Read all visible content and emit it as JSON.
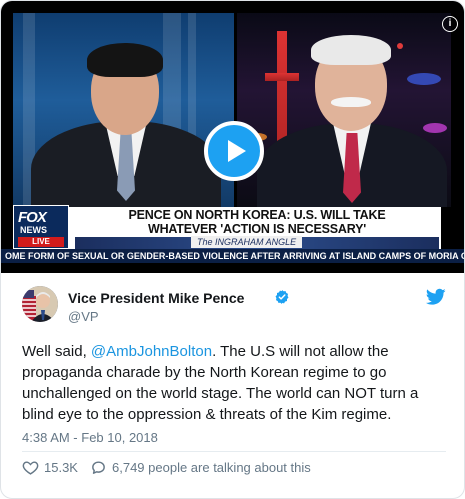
{
  "media": {
    "headline_line1": "PENCE ON NORTH KOREA: U.S. WILL TAKE",
    "headline_line2": "WHATEVER 'ACTION IS NECESSARY'",
    "channel_name": "FOX",
    "channel_sub": "NEWS",
    "live_label": "LIVE",
    "show_name": "The INGRAHAM ANGLE",
    "ticker": "OME FORM OF SEXUAL OR GENDER-BASED VIOLENCE AFTER ARRIVING AT ISLAND CAMPS OF MORIA ON LE",
    "play_icon": "play-icon",
    "info_label": "i"
  },
  "tweet": {
    "author_name": "Vice President Mike Pence",
    "author_handle": "@VP",
    "verified_icon": "verified-badge-icon",
    "brand_icon": "twitter-bird-icon",
    "text_before": "Well said, ",
    "mention": "@AmbJohnBolton",
    "text_after": ". The U.S will not allow the propaganda charade by the North Korean regime to go unchallenged on the world stage. The world can NOT turn a blind eye to the oppression & threats of the Kim regime.",
    "timestamp": "4:38 AM - Feb 10, 2018",
    "likes": "15.3K",
    "talking": "6,749 people are talking about this"
  },
  "colors": {
    "accent": "#1da1f2",
    "mention": "#1b95e0",
    "muted": "#657786",
    "text": "#14171a"
  }
}
